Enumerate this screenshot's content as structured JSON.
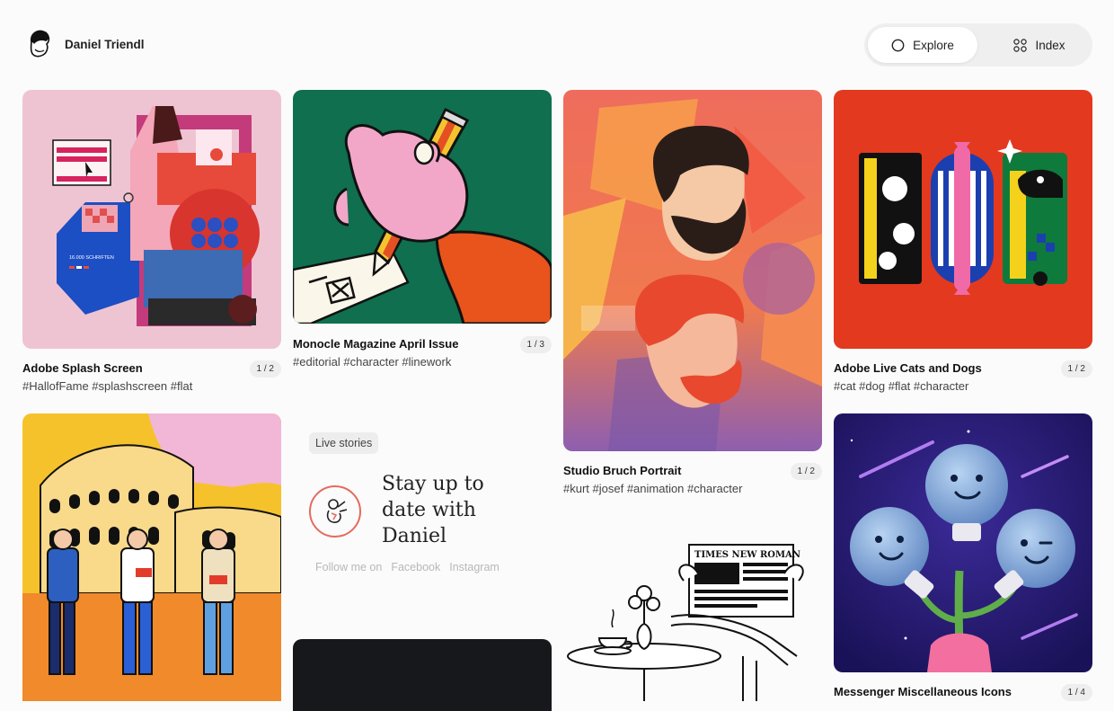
{
  "header": {
    "brand_name": "Daniel Triendl",
    "nav": {
      "explore_label": "Explore",
      "index_label": "Index"
    }
  },
  "cards": [
    {
      "title": "Adobe Splash Screen",
      "tags": "#HallofFame #splashscreen #flat",
      "counter": "1 / 2"
    },
    {
      "title": "Monocle Magazine April Issue",
      "tags": "#editorial #character #linework",
      "counter": "1 / 3"
    },
    {
      "title": "Studio Bruch Portrait",
      "tags": "#kurt #josef #animation #character",
      "counter": "1 / 2"
    },
    {
      "title": "Adobe Live Cats and Dogs",
      "tags": "#cat #dog #flat #character",
      "counter": "1 / 2"
    },
    {
      "title": "Messenger Miscellaneous Icons",
      "tags": "",
      "counter": "1 / 4"
    }
  ],
  "live": {
    "badge": "Live stories",
    "headline": "Stay up to date with Daniel",
    "follow_label": "Follow me on",
    "facebook_label": "Facebook",
    "instagram_label": "Instagram"
  },
  "artwork_text": {
    "schriften": "16.000 SCHRIFTEN",
    "newspaper": "TIMES NEW ROMAN"
  },
  "colors": {
    "page_bg": "#fbfbfb",
    "toggle_bg": "#efefef",
    "live_accent": "#e46b5d",
    "follow_text": "#b8b8b8"
  }
}
